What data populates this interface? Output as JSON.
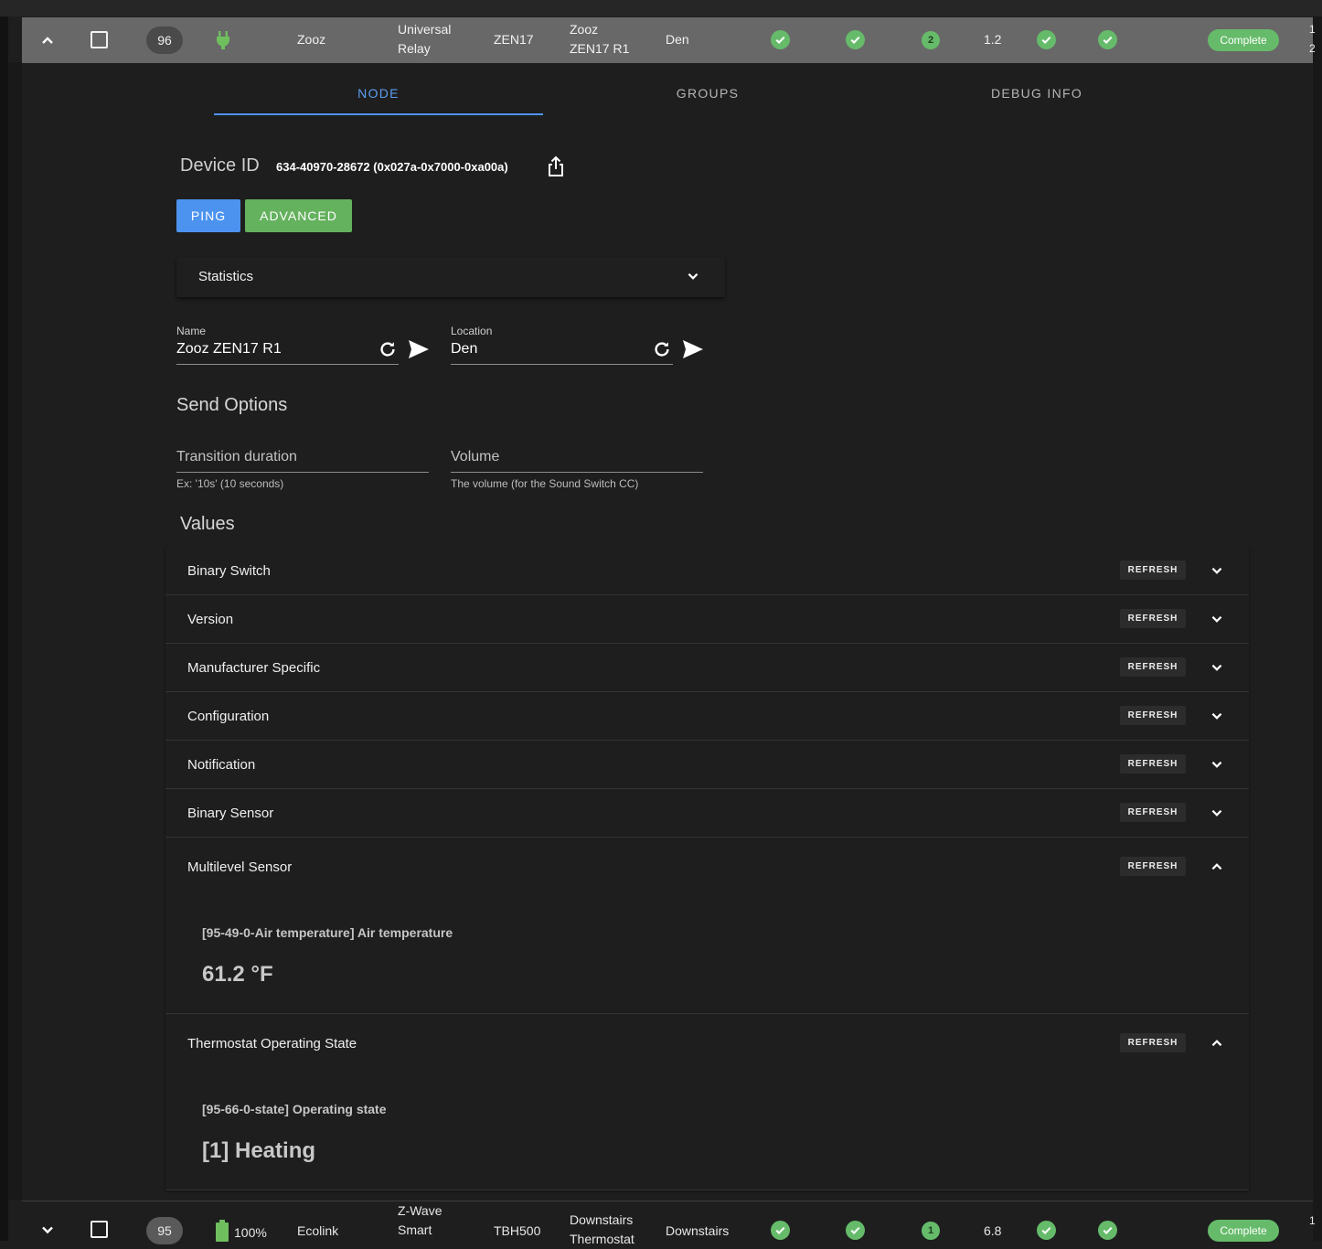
{
  "colors": {
    "accent_blue": "#4c93ef",
    "accent_green": "#64b15e",
    "status_ok": "#66bb6a"
  },
  "expanded_row": {
    "id": "96",
    "power_icon": "plug-icon",
    "manufacturer": "Zooz",
    "product_line1": "Universal",
    "product_line2": "Relay",
    "model": "ZEN17",
    "name_line1": "Zooz",
    "name_line2": "ZEN17 R1",
    "location": "Den",
    "security_badge": "2",
    "version": "1.2",
    "status": "Complete",
    "edge_line1": "1",
    "edge_line2": "2"
  },
  "tabs": [
    {
      "label": "NODE",
      "active": true
    },
    {
      "label": "GROUPS",
      "active": false
    },
    {
      "label": "DEBUG INFO",
      "active": false
    }
  ],
  "device": {
    "label": "Device ID",
    "value": "634-40970-28672 (0x027a-0x7000-0xa00a)"
  },
  "buttons": {
    "ping": "PING",
    "advanced": "ADVANCED"
  },
  "statistics": {
    "label": "Statistics"
  },
  "name_field": {
    "label": "Name",
    "value": "Zooz ZEN17 R1"
  },
  "location_field": {
    "label": "Location",
    "value": "Den"
  },
  "send_options": {
    "title": "Send Options",
    "transition": {
      "placeholder": "Transition duration",
      "hint": "Ex: '10s' (10 seconds)"
    },
    "volume": {
      "placeholder": "Volume",
      "hint": "The volume (for the Sound Switch CC)"
    }
  },
  "values": {
    "title": "Values",
    "refresh_label": "REFRESH",
    "panels": [
      {
        "title": "Binary Switch",
        "expanded": false
      },
      {
        "title": "Version",
        "expanded": false
      },
      {
        "title": "Manufacturer Specific",
        "expanded": false
      },
      {
        "title": "Configuration",
        "expanded": false
      },
      {
        "title": "Notification",
        "expanded": false
      },
      {
        "title": "Binary Sensor",
        "expanded": false
      },
      {
        "title": "Multilevel Sensor",
        "expanded": true,
        "value_label": "[95-49-0-Air temperature] Air temperature",
        "value": "61.2 °F"
      },
      {
        "title": "Thermostat Operating State",
        "expanded": true,
        "value_label": "[95-66-0-state] Operating state",
        "value": "[1] Heating"
      }
    ]
  },
  "next_row": {
    "id": "95",
    "battery": "100%",
    "manufacturer": "Ecolink",
    "product_line1": "Z-Wave",
    "product_line2": "Smart",
    "model": "TBH500",
    "name_line1": "Downstairs",
    "name_line2": "Thermostat",
    "location": "Downstairs",
    "security_badge": "1",
    "version": "6.8",
    "status": "Complete",
    "edge_line1": "1"
  }
}
